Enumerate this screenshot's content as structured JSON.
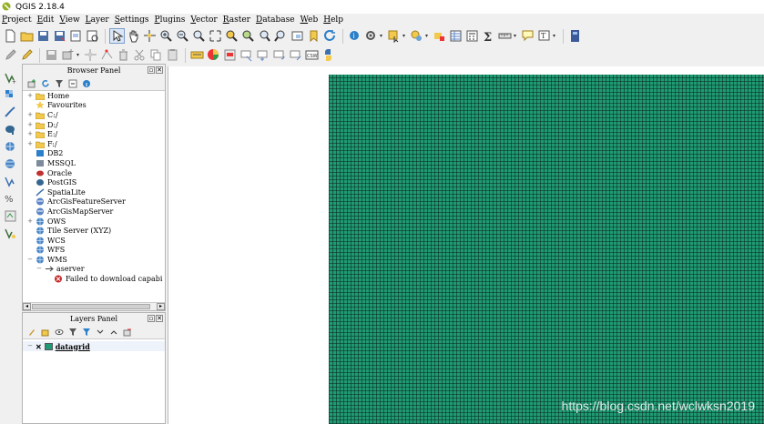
{
  "window": {
    "title": "QGIS 2.18.4"
  },
  "menu": [
    "Project",
    "Edit",
    "View",
    "Layer",
    "Settings",
    "Plugins",
    "Vector",
    "Raster",
    "Database",
    "Web",
    "Help"
  ],
  "browser_panel": {
    "title": "Browser Panel",
    "items": [
      {
        "label": "Home",
        "icon": "folder-icon",
        "expand": "+"
      },
      {
        "label": "Favourites",
        "icon": "star-icon",
        "expand": ""
      },
      {
        "label": "C:/",
        "icon": "folder-icon",
        "expand": "+"
      },
      {
        "label": "D:/",
        "icon": "folder-icon",
        "expand": "+"
      },
      {
        "label": "E:/",
        "icon": "folder-icon",
        "expand": "+"
      },
      {
        "label": "F:/",
        "icon": "folder-icon",
        "expand": "+"
      },
      {
        "label": "DB2",
        "icon": "db2-icon",
        "expand": ""
      },
      {
        "label": "MSSQL",
        "icon": "mssql-icon",
        "expand": ""
      },
      {
        "label": "Oracle",
        "icon": "oracle-icon",
        "expand": ""
      },
      {
        "label": "PostGIS",
        "icon": "postgis-icon",
        "expand": ""
      },
      {
        "label": "SpatiaLite",
        "icon": "spatialite-icon",
        "expand": ""
      },
      {
        "label": "ArcGisFeatureServer",
        "icon": "arcgis-icon",
        "expand": ""
      },
      {
        "label": "ArcGisMapServer",
        "icon": "arcgis-icon",
        "expand": ""
      },
      {
        "label": "OWS",
        "icon": "globe-icon",
        "expand": "+"
      },
      {
        "label": "Tile Server (XYZ)",
        "icon": "globe-icon",
        "expand": ""
      },
      {
        "label": "WCS",
        "icon": "globe-icon",
        "expand": ""
      },
      {
        "label": "WFS",
        "icon": "globe-icon",
        "expand": ""
      },
      {
        "label": "WMS",
        "icon": "globe-icon",
        "expand": "−"
      },
      {
        "label": "aserver",
        "icon": "connection-icon",
        "expand": "−",
        "indent": 1
      },
      {
        "label": "Failed to download capabi",
        "icon": "error-icon",
        "expand": "",
        "indent": 2
      }
    ]
  },
  "layers_panel": {
    "title": "Layers Panel",
    "layers": [
      {
        "label": "datagrid",
        "visible": "✕",
        "color": "#1f9b74"
      }
    ]
  },
  "canvas": {
    "layer_color": "#1f9b74"
  },
  "watermark": "https://blog.csdn.net/wclwksn2019"
}
